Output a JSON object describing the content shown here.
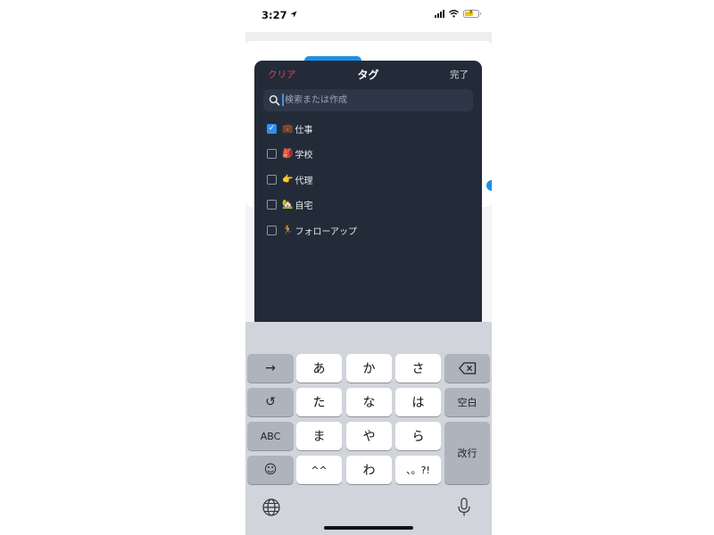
{
  "status_bar": {
    "time": "3:27"
  },
  "tag_sheet": {
    "clear_label": "クリア",
    "title": "タグ",
    "done_label": "完了",
    "search": {
      "placeholder": "検索または作成",
      "value": ""
    },
    "tags": [
      {
        "emoji": "💼",
        "label": "仕事",
        "checked": true
      },
      {
        "emoji": "🎒",
        "label": "学校",
        "checked": false
      },
      {
        "emoji": "👉",
        "label": "代理",
        "checked": false
      },
      {
        "emoji": "🏡",
        "label": "自宅",
        "checked": false
      },
      {
        "emoji": "🏃",
        "label": "フォローアップ",
        "checked": false
      }
    ]
  },
  "keyboard": {
    "arrow_key": "→",
    "undo_key": "↺",
    "abc_key": "ABC",
    "emoji_key": "☺",
    "row1": [
      "あ",
      "か",
      "さ"
    ],
    "row2": [
      "た",
      "な",
      "は"
    ],
    "row3": [
      "ま",
      "や",
      "ら"
    ],
    "row4": [
      "^^",
      "わ",
      "、。?!"
    ],
    "backspace_key": "⌫",
    "space_key": "空白",
    "return_key": "改行"
  },
  "colors": {
    "sheet_bg": "#232b39",
    "accent_blue": "#2f8ff0",
    "clear_red": "#e0454f",
    "keyboard_bg": "#d1d4da"
  }
}
